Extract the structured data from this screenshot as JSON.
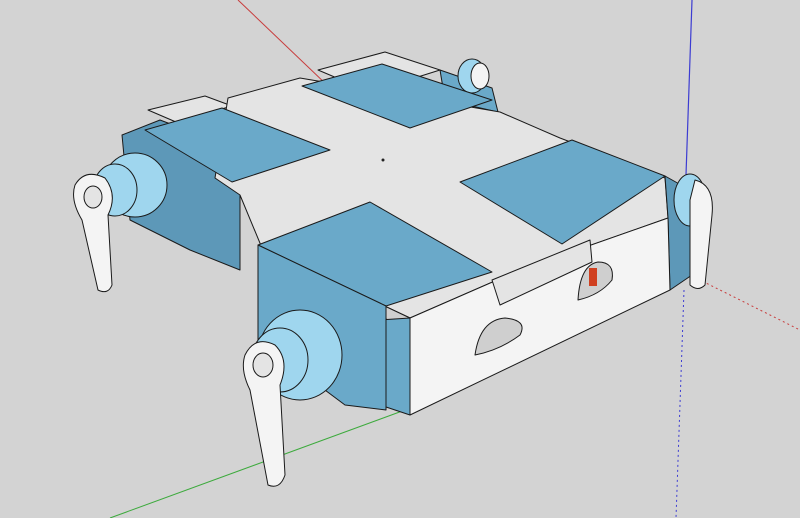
{
  "viewport": {
    "background_color": "#d3d3d3",
    "axis_colors": {
      "red": "#c83c3c",
      "green": "#3caa3c",
      "blue": "#3c3cd2"
    },
    "model_colors": {
      "servo_blue": "#6aa9c9",
      "servo_side": "#5d98b8",
      "plate": "#e4e4e4",
      "plate_side": "#cfcfcf",
      "bracket_white": "#f4f4f4",
      "horn_light": "#9fd6ee"
    }
  }
}
